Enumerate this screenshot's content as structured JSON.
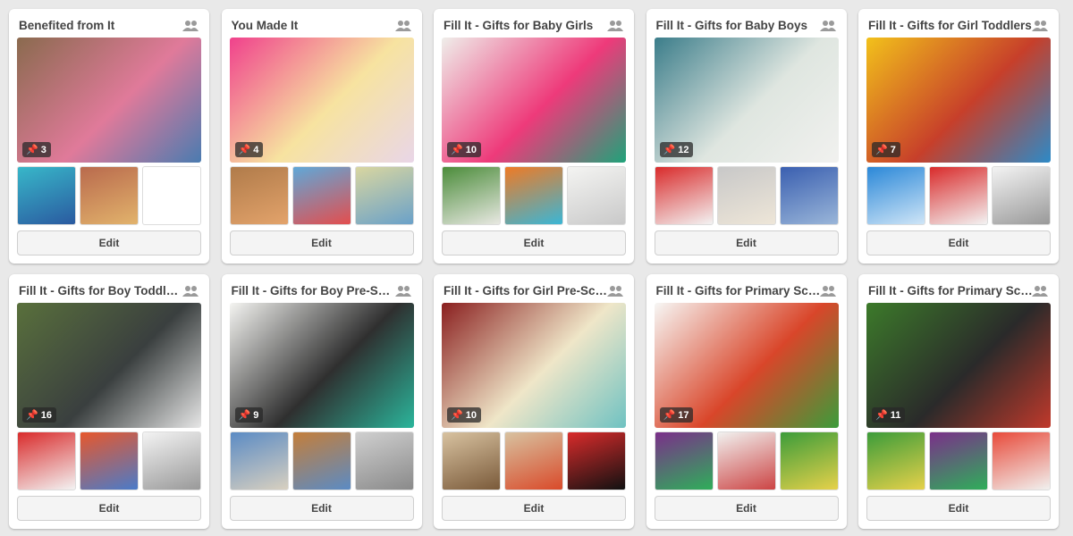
{
  "boards": [
    {
      "title": "Benefited from It",
      "pin_count": "3",
      "edit_label": "Edit",
      "cover_colors": [
        "#8a6a4e",
        "#e07a9a",
        "#4a7bb0"
      ],
      "thumb_colors": [
        [
          "#38b7c9",
          "#2a5aa0"
        ],
        [
          "#b96a4d",
          "#e2b36c"
        ],
        [
          "#ffffff",
          "#ffffff"
        ]
      ]
    },
    {
      "title": "You Made It",
      "pin_count": "4",
      "edit_label": "Edit",
      "cover_colors": [
        "#f0418c",
        "#f7e3a0",
        "#e9d6e8"
      ],
      "thumb_colors": [
        [
          "#b07b4a",
          "#e3a36b"
        ],
        [
          "#5fa8d8",
          "#e34e4e"
        ],
        [
          "#d9d6a0",
          "#6aa1c9"
        ]
      ]
    },
    {
      "title": "Fill It - Gifts for Baby Girls",
      "pin_count": "10",
      "edit_label": "Edit",
      "cover_colors": [
        "#efeeea",
        "#ee3a7a",
        "#1fa37a"
      ],
      "thumb_colors": [
        [
          "#4b8c3a",
          "#e8e8e2"
        ],
        [
          "#ef7a25",
          "#3ab6d6"
        ],
        [
          "#f4f4f2",
          "#c9c9c9"
        ]
      ]
    },
    {
      "title": "Fill It - Gifts for Baby Boys",
      "pin_count": "12",
      "edit_label": "Edit",
      "cover_colors": [
        "#3b7d8a",
        "#dfe6e0",
        "#f1f1ef"
      ],
      "thumb_colors": [
        [
          "#d92b2b",
          "#f3f3f3"
        ],
        [
          "#c8c8c8",
          "#eee6d8"
        ],
        [
          "#3a5fb0",
          "#9ab6d9"
        ]
      ]
    },
    {
      "title": "Fill It - Gifts for Girl Toddlers",
      "pin_count": "7",
      "edit_label": "Edit",
      "cover_colors": [
        "#f2c11b",
        "#c73f2a",
        "#2d8ac7"
      ],
      "thumb_colors": [
        [
          "#2b88d8",
          "#cfe5f7"
        ],
        [
          "#d92b2b",
          "#f3f3f3"
        ],
        [
          "#f3f3f3",
          "#999999"
        ]
      ]
    },
    {
      "title": "Fill It - Gifts for Boy Toddlers",
      "pin_count": "16",
      "edit_label": "Edit",
      "cover_colors": [
        "#59703c",
        "#3a3f3f",
        "#e7e7e7"
      ],
      "thumb_colors": [
        [
          "#d92b2b",
          "#f3f3f3"
        ],
        [
          "#e7572c",
          "#4a7bc9"
        ],
        [
          "#f3f3f3",
          "#999999"
        ]
      ]
    },
    {
      "title": "Fill It - Gifts for Boy Pre-Schoolers",
      "pin_count": "9",
      "edit_label": "Edit",
      "cover_colors": [
        "#f4f4f1",
        "#2f2f2f",
        "#2bb59b"
      ],
      "thumb_colors": [
        [
          "#5b8bc4",
          "#d8d0c0"
        ],
        [
          "#c47e3a",
          "#5b8bc4"
        ],
        [
          "#cfcfcf",
          "#8a8a8a"
        ]
      ]
    },
    {
      "title": "Fill It - Gifts for Girl Pre-Schoolers",
      "pin_count": "10",
      "edit_label": "Edit",
      "cover_colors": [
        "#8a1f1f",
        "#efe6c8",
        "#6fc2c2"
      ],
      "thumb_colors": [
        [
          "#d8c2a0",
          "#7a5a3a"
        ],
        [
          "#d8c2a0",
          "#d94a2a"
        ],
        [
          "#d92b2b",
          "#111111"
        ]
      ]
    },
    {
      "title": "Fill It - Gifts for Primary Schoolers",
      "pin_count": "17",
      "edit_label": "Edit",
      "cover_colors": [
        "#f7f7f5",
        "#d9462a",
        "#3c9c3a"
      ],
      "thumb_colors": [
        [
          "#7b2f8a",
          "#2fae5a"
        ],
        [
          "#f1f1ef",
          "#cc4444"
        ],
        [
          "#3c9c3a",
          "#e6d14a"
        ]
      ]
    },
    {
      "title": "Fill It - Gifts for Primary Schoolers",
      "pin_count": "11",
      "edit_label": "Edit",
      "cover_colors": [
        "#3c7a2a",
        "#2a2a2a",
        "#c0392b"
      ],
      "thumb_colors": [
        [
          "#3c9c3a",
          "#e6d14a"
        ],
        [
          "#7b2f8a",
          "#2fae5a"
        ],
        [
          "#e84a3a",
          "#f1f1ef"
        ]
      ]
    }
  ]
}
